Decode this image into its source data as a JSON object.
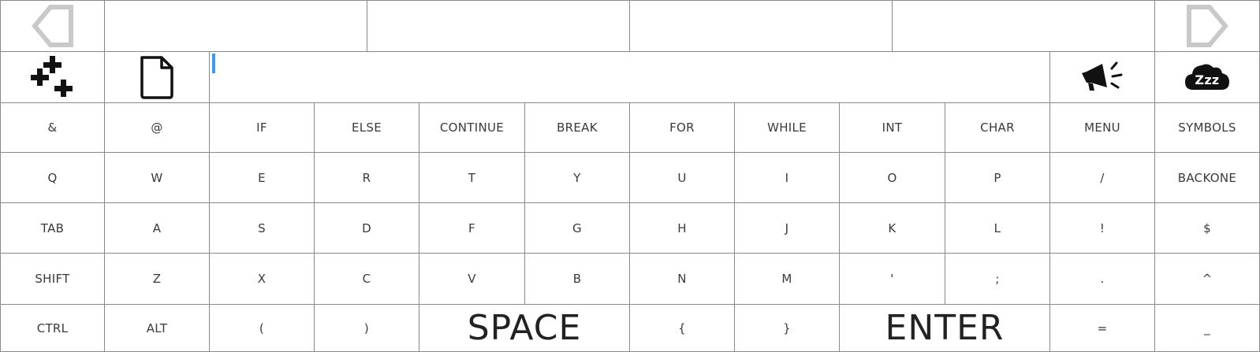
{
  "top_bar": {
    "prev_icon": "arrow-left-outline-icon",
    "next_icon": "arrow-right-outline-icon",
    "suggestions": [
      "",
      "",
      "",
      ""
    ]
  },
  "toolbar": {
    "add_icon": "triple-plus-icon",
    "file_icon": "document-icon",
    "input_value": "",
    "speak_icon": "megaphone-icon",
    "sleep_icon": "cloud-zzz-icon",
    "sleep_text": "Zzz"
  },
  "rows": [
    [
      "&",
      "@",
      "IF",
      "ELSE",
      "CONTINUE",
      "BREAK",
      "FOR",
      "WHILE",
      "INT",
      "CHAR",
      "MENU",
      "SYMBOLS"
    ],
    [
      "Q",
      "W",
      "E",
      "R",
      "T",
      "Y",
      "U",
      "I",
      "O",
      "P",
      "/",
      "BACKONE"
    ],
    [
      "TAB",
      "A",
      "S",
      "D",
      "F",
      "G",
      "H",
      "J",
      "K",
      "L",
      "!",
      "$"
    ],
    [
      "SHIFT",
      "Z",
      "X",
      "C",
      "V",
      "B",
      "N",
      "M",
      "'",
      ";",
      ".",
      "^"
    ]
  ],
  "bottom_row": {
    "ctrl": "CTRL",
    "alt": "ALT",
    "open_paren": "(",
    "close_paren": ")",
    "space": "SPACE",
    "open_brace": "{",
    "close_brace": "}",
    "enter": "ENTER",
    "equals": "=",
    "underscore": "_"
  }
}
